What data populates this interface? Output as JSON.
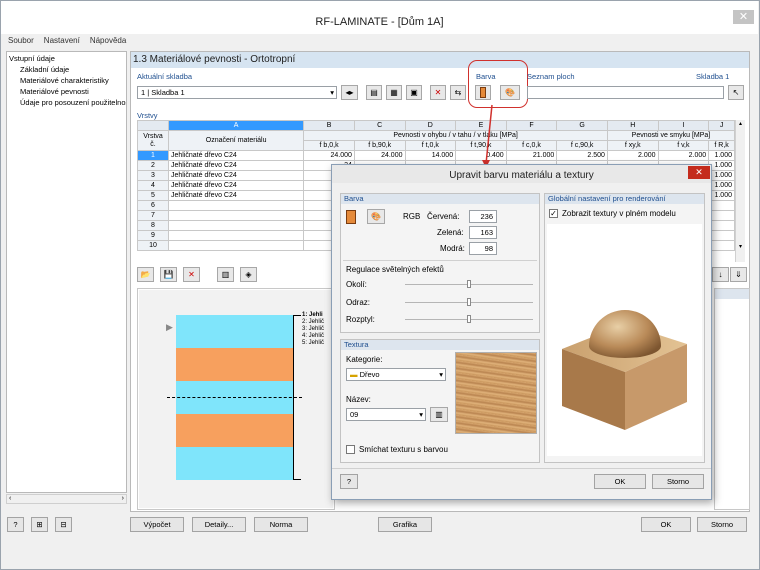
{
  "window": {
    "title": "RF-LAMINATE - [Dům 1A]"
  },
  "menu": [
    "Soubor",
    "Nastavení",
    "Nápověda"
  ],
  "tree": {
    "root": "Vstupní údaje",
    "items": [
      "Základní údaje",
      "Materiálové charakteristiky",
      "Materiálové pevnosti",
      "Údaje pro posouzení použitelnosti"
    ]
  },
  "panel": {
    "header": "1.3 Materiálové pevnosti - Ortotropní",
    "current_layup_label": "Aktuální skladba",
    "current_layup_value": "1 | Skladba 1",
    "color_label": "Barva",
    "area_list_label": "Seznam ploch",
    "layup_tag": "Skladba 1",
    "layers_label": "Vrstvy"
  },
  "table": {
    "col_letters": [
      "A",
      "B",
      "C",
      "D",
      "E",
      "F",
      "G",
      "H",
      "I",
      "J"
    ],
    "hdr_layer": "Vrstva č.",
    "hdr_material": "Označení materiálu",
    "hdr_group1": "Pevnosti v ohybu / v tahu / v tlaku [MPa]",
    "hdr_group2": "Pevnosti ve smyku [MPa]",
    "sub": [
      "f b,0,k",
      "f b,90,k",
      "f t,0,k",
      "f t,90,k",
      "f c,0,k",
      "f c,90,k",
      "f xy,k",
      "f v,k",
      "f R,k"
    ],
    "rows": [
      {
        "n": "1",
        "m": "Jehličnaté dřevo C24",
        "v": [
          "24.000",
          "24.000",
          "14.000",
          "0.400",
          "21.000",
          "2.500",
          "2.000",
          "2.000",
          "1.000"
        ]
      },
      {
        "n": "2",
        "m": "Jehličnaté dřevo C24",
        "v": [
          "24",
          "",
          "",
          "",
          "",
          "",
          "",
          "",
          "1.000"
        ]
      },
      {
        "n": "3",
        "m": "Jehličnaté dřevo C24",
        "v": [
          "24",
          "",
          "",
          "",
          "",
          "",
          "",
          "",
          "1.000"
        ]
      },
      {
        "n": "4",
        "m": "Jehličnaté dřevo C24",
        "v": [
          "24",
          "",
          "",
          "",
          "",
          "",
          "",
          "",
          "1.000"
        ]
      },
      {
        "n": "5",
        "m": "Jehličnaté dřevo C24",
        "v": [
          "24",
          "",
          "",
          "",
          "",
          "",
          "",
          "",
          "1.000"
        ]
      },
      {
        "n": "6",
        "m": "",
        "v": [
          "",
          "",
          "",
          "",
          "",
          "",
          "",
          "",
          ""
        ]
      },
      {
        "n": "7",
        "m": "",
        "v": [
          "",
          "",
          "",
          "",
          "",
          "",
          "",
          "",
          ""
        ]
      },
      {
        "n": "8",
        "m": "",
        "v": [
          "",
          "",
          "",
          "",
          "",
          "",
          "",
          "",
          ""
        ]
      },
      {
        "n": "9",
        "m": "",
        "v": [
          "",
          "",
          "",
          "",
          "",
          "",
          "",
          "",
          ""
        ]
      },
      {
        "n": "10",
        "m": "",
        "v": [
          "",
          "",
          "",
          "",
          "",
          "",
          "",
          "",
          ""
        ]
      }
    ]
  },
  "preview_labels": [
    "1: Jehli",
    "2: Jehlič",
    "3: Jehlič",
    "4: Jehlič",
    "5: Jehlič"
  ],
  "bottom": {
    "calc": "Výpočet",
    "details": "Detaily...",
    "norm": "Norma",
    "graphics": "Grafika",
    "ok": "OK",
    "cancel": "Storno"
  },
  "dialog": {
    "title": "Upravit barvu materiálu a textury",
    "color_group": "Barva",
    "rgb": "RGB",
    "red_label": "Červená:",
    "green_label": "Zelená:",
    "blue_label": "Modrá:",
    "red": "236",
    "green": "163",
    "blue": "98",
    "light_label": "Regulace světelných efektů",
    "ambient": "Okolí:",
    "reflect": "Odraz:",
    "diffuse": "Rozptyl:",
    "texture_group": "Textura",
    "category_label": "Kategorie:",
    "category_value": "Dřevo",
    "name_label": "Název:",
    "name_value": "09",
    "mix_label": "Smíchat texturu s barvou",
    "global_group": "Globální nastavení pro renderování",
    "show_textures": "Zobrazit textury v plném modelu",
    "ok": "OK",
    "cancel": "Storno"
  },
  "colors": {
    "accent": "#e58a3a",
    "layer_blue": "#7fe5fb",
    "layer_orange": "#f7a05e",
    "selection": "#3399ff"
  }
}
